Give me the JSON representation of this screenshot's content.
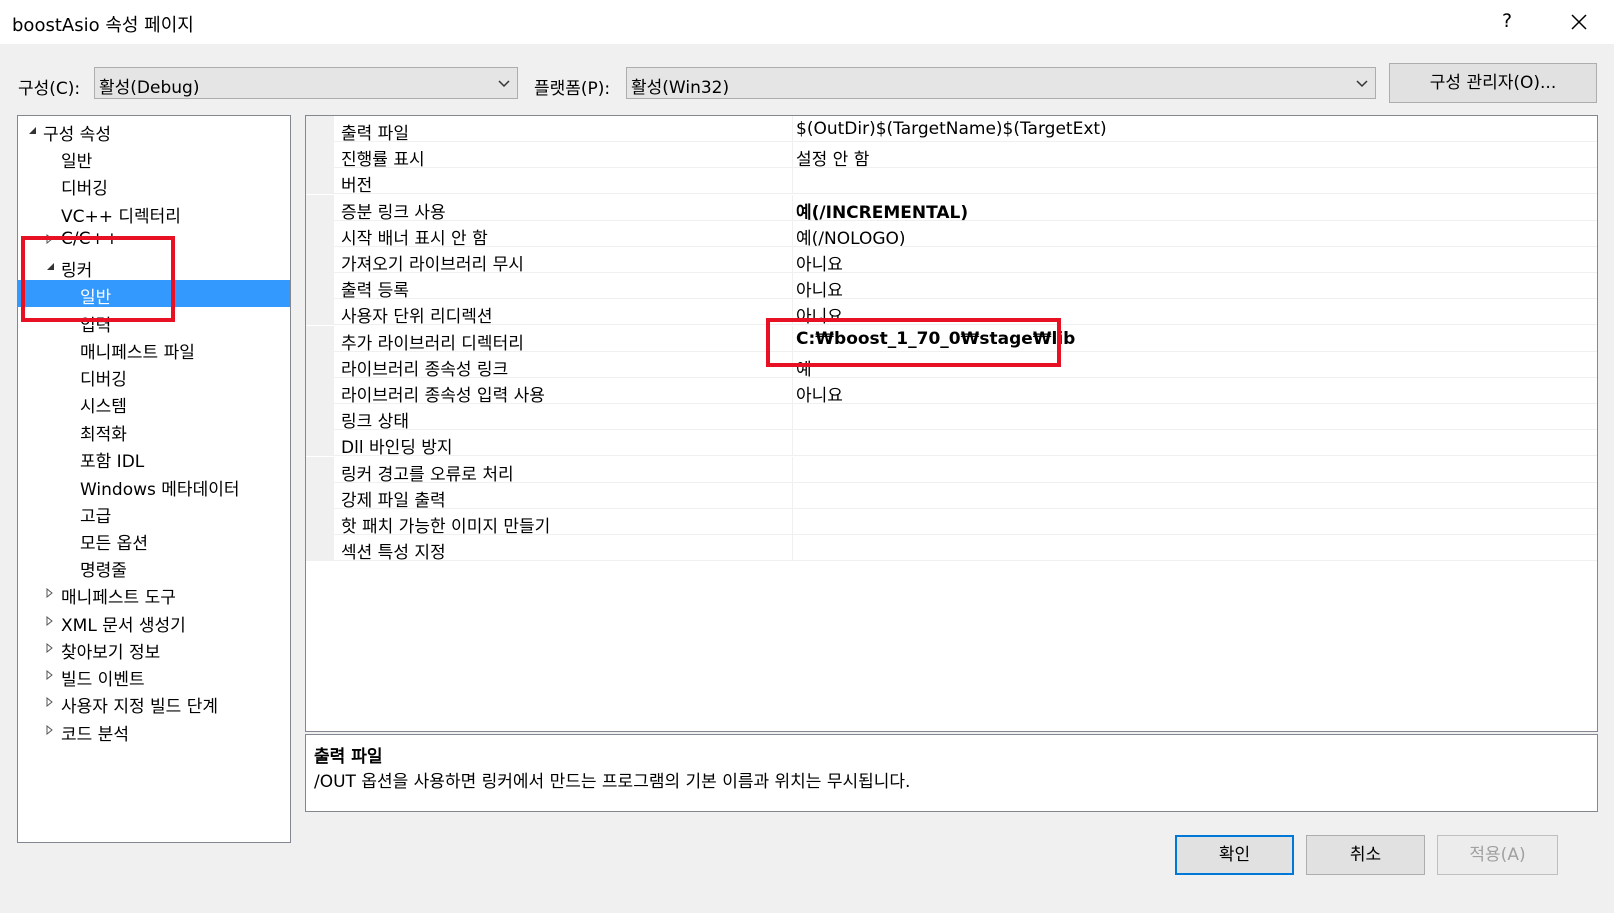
{
  "window": {
    "title": "boostAsio 속성 페이지",
    "help_label": "?"
  },
  "toolbar": {
    "config_label": "구성(C):",
    "config_value": "활성(Debug)",
    "platform_label": "플랫폼(P):",
    "platform_value": "활성(Win32)",
    "config_manager_label": "구성 관리자(O)..."
  },
  "tree": {
    "items": [
      {
        "label": "구성 속성",
        "expander": "expanded"
      },
      {
        "label": "일반"
      },
      {
        "label": "디버깅"
      },
      {
        "label": "VC++ 디렉터리"
      },
      {
        "label": "C/C++",
        "expander": "collapsed"
      },
      {
        "label": "링커",
        "expander": "expanded"
      },
      {
        "label": "일반",
        "selected": true
      },
      {
        "label": "입력"
      },
      {
        "label": "매니페스트 파일"
      },
      {
        "label": "디버깅"
      },
      {
        "label": "시스템"
      },
      {
        "label": "최적화"
      },
      {
        "label": "포함 IDL"
      },
      {
        "label": "Windows 메타데이터"
      },
      {
        "label": "고급"
      },
      {
        "label": "모든 옵션"
      },
      {
        "label": "명령줄"
      },
      {
        "label": "매니페스트 도구",
        "expander": "collapsed"
      },
      {
        "label": "XML 문서 생성기",
        "expander": "collapsed"
      },
      {
        "label": "찾아보기 정보",
        "expander": "collapsed"
      },
      {
        "label": "빌드 이벤트",
        "expander": "collapsed"
      },
      {
        "label": "사용자 지정 빌드 단계",
        "expander": "collapsed"
      },
      {
        "label": "코드 분석",
        "expander": "collapsed"
      }
    ]
  },
  "properties": [
    {
      "name": "출력 파일",
      "value": "$(OutDir)$(TargetName)$(TargetExt)"
    },
    {
      "name": "진행률 표시",
      "value": "설정 안 함"
    },
    {
      "name": "버전",
      "value": ""
    },
    {
      "name": "증분 링크 사용",
      "value": "예(/INCREMENTAL)",
      "bold": true
    },
    {
      "name": "시작 배너 표시 안 함",
      "value": "예(/NOLOGO)"
    },
    {
      "name": "가져오기 라이브러리 무시",
      "value": "아니요"
    },
    {
      "name": "출력 등록",
      "value": "아니요"
    },
    {
      "name": "사용자 단위 리디렉션",
      "value": "아니요"
    },
    {
      "name": "추가 라이브러리 디렉터리",
      "value": "C:₩boost_1_70_0₩stage₩lib",
      "bold": true
    },
    {
      "name": "라이브러리 종속성 링크",
      "value": "예"
    },
    {
      "name": "라이브러리 종속성 입력 사용",
      "value": "아니요"
    },
    {
      "name": "링크 상태",
      "value": ""
    },
    {
      "name": "Dll 바인딩 방지",
      "value": ""
    },
    {
      "name": "링커 경고를 오류로 처리",
      "value": ""
    },
    {
      "name": "강제 파일 출력",
      "value": ""
    },
    {
      "name": "핫 패치 가능한 이미지 만들기",
      "value": ""
    },
    {
      "name": "섹션 특성 지정",
      "value": ""
    }
  ],
  "description": {
    "title": "출력 파일",
    "text": "/OUT 옵션을 사용하면 링커에서 만드는 프로그램의 기본 이름과 위치는 무시됩니다."
  },
  "buttons": {
    "ok": "확인",
    "cancel": "취소",
    "apply": "적용(A)"
  },
  "colors": {
    "selection": "#3399ff",
    "highlight_box": "#e81123",
    "primary_border": "#0078d7"
  }
}
